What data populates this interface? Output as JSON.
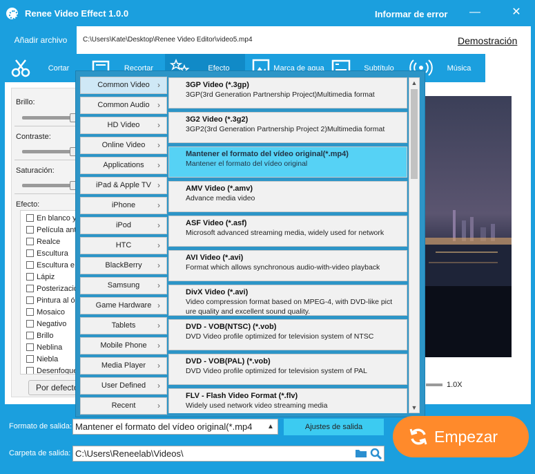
{
  "app": {
    "title": "Renee Video Effect 1.0.0",
    "report_error": "Informar de error",
    "controls": {
      "minimize": "—",
      "close": "✕"
    }
  },
  "file": {
    "add_button": "Añadir archivo",
    "path": "C:\\Users\\Kate\\Desktop\\Renee Video Editor\\video5.mp4",
    "demo_link": "Demostración"
  },
  "tabs": [
    {
      "label": "Cortar",
      "icon": "scissors-icon"
    },
    {
      "label": "Recortar",
      "icon": "crop-icon"
    },
    {
      "label": "Efecto",
      "icon": "effect-stars-icon"
    },
    {
      "label": "Marca de agua",
      "icon": "watermark-icon"
    },
    {
      "label": "Subtítulo",
      "icon": "subtitle-icon"
    },
    {
      "label": "Música",
      "icon": "music-icon"
    }
  ],
  "left_panel": {
    "brightness_label": "Brillo:",
    "contrast_label": "Contraste:",
    "saturation_label": "Saturación:",
    "effects_label": "Efecto:",
    "effects": [
      "En blanco y",
      "Película ant",
      "Realce",
      "Escultura",
      "Escultura e",
      "Lápiz",
      "Posterizació",
      "Pintura al ó",
      "Mosaico",
      "Negativo",
      "Brillo",
      "Neblina",
      "Niebla",
      "Desenfoque"
    ],
    "default_button": "Por defecto"
  },
  "preview": {
    "zoom": "1.0X"
  },
  "format_menu": {
    "categories": [
      "Common Video",
      "Common Audio",
      "HD Video",
      "Online Video",
      "Applications",
      "iPad & Apple TV",
      "iPhone",
      "iPod",
      "HTC",
      "BlackBerry",
      "Samsung",
      "Game Hardware",
      "Tablets",
      "Mobile Phone",
      "Media Player",
      "User Defined",
      "Recent"
    ],
    "active_category": "Common Video",
    "formats": [
      {
        "name": "3GP Video (*.3gp)",
        "desc": "3GP(3rd Generation Partnership Project)Multimedia format"
      },
      {
        "name": "3G2 Video (*.3g2)",
        "desc": "3GP2(3rd Generation Partnership Project 2)Multimedia format"
      },
      {
        "name": "Mantener el formato del vídeo original(*.mp4)",
        "desc": "Mantener el formato del vídeo original"
      },
      {
        "name": "AMV Video (*.amv)",
        "desc": "Advance media video"
      },
      {
        "name": "ASF Video (*.asf)",
        "desc": "Microsoft advanced streaming media, widely used for network"
      },
      {
        "name": "AVI Video (*.avi)",
        "desc": "Format which allows synchronous audio-with-video playback"
      },
      {
        "name": "DivX Video (*.avi)",
        "desc": "Video compression format based on MPEG-4, with DVD-like pict",
        "desc2": "ure quality and excellent sound quality."
      },
      {
        "name": "DVD - VOB(NTSC) (*.vob)",
        "desc": "DVD Video profile optimized for television system of NTSC"
      },
      {
        "name": "DVD - VOB(PAL) (*.vob)",
        "desc": "DVD Video profile optimized for television system of PAL"
      },
      {
        "name": "FLV - Flash Video Format (*.flv)",
        "desc": "Widely used network video streaming media"
      }
    ],
    "selected_format": "Mantener el formato del vídeo original(*.mp4)"
  },
  "output": {
    "format_label": "Formato de salida:",
    "format_value": "Mantener el formato del vídeo original(*.mp4",
    "settings_button": "Ajustes de salida",
    "folder_label": "Carpeta de salida:",
    "folder_value": "C:\\Users\\Reneelab\\Videos\\",
    "start_button": "Empezar"
  },
  "colors": {
    "primary": "#1b9fde",
    "selected": "#56d2f5",
    "start": "#ff8a2b",
    "settings": "#3ccbf1"
  }
}
